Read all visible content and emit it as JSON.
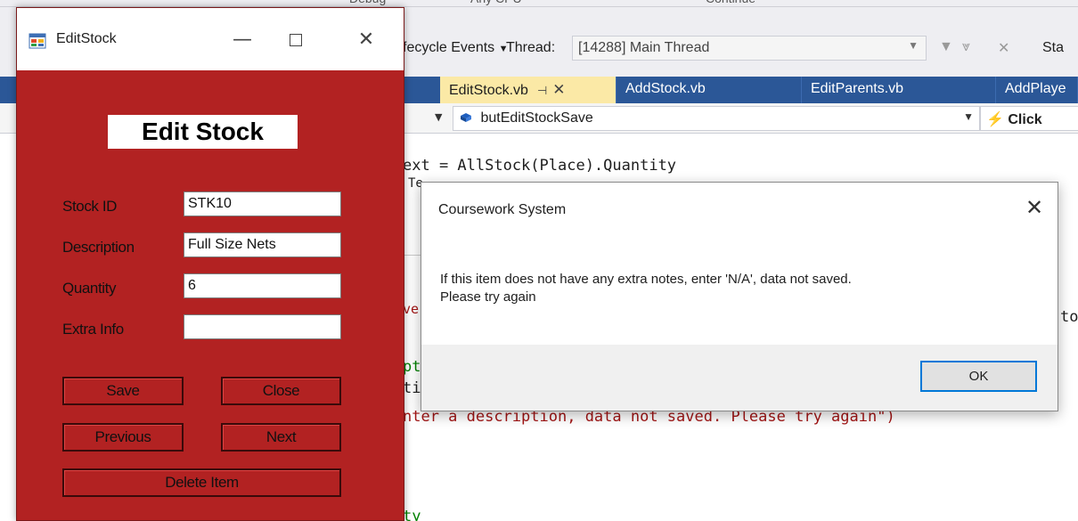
{
  "vs": {
    "top_fragments": [
      "Debug",
      "Any CPU",
      "Continue"
    ],
    "lifecycle_label": "fecycle Events",
    "thread_label": "Thread:",
    "thread_value": "[14288] Main Thread",
    "stack_label": "Sta",
    "tabs": [
      {
        "label": "EditStock.vb",
        "active": true
      },
      {
        "label": "AddStock.vb"
      },
      {
        "label": "EditParents.vb"
      },
      {
        "label": "AddPlaye"
      }
    ],
    "member_dropdown": "butEditStockSave",
    "event_dropdown": "Click",
    "code_lines": [
      "ext = AllStock(Place).Quantity",
      "Te",
      "ve",
      "pt",
      "ti",
      "nter a description, data not saved. Please try again\")",
      "ty"
    ],
    "code_right_fragment": "to",
    "colors": {
      "tab_strip": "#2b5797",
      "active_tab": "#fbe9a6",
      "string": "#a31515"
    }
  },
  "editstock": {
    "window_title": "EditStock",
    "heading": "Edit Stock",
    "fields": {
      "stock_id": {
        "label": "Stock ID",
        "value": "STK10"
      },
      "description": {
        "label": "Description",
        "value": "Full Size Nets"
      },
      "quantity": {
        "label": "Quantity",
        "value": "6"
      },
      "extra_info": {
        "label": "Extra Info",
        "value": ""
      }
    },
    "buttons": {
      "save": "Save",
      "close": "Close",
      "previous": "Previous",
      "next": "Next",
      "delete": "Delete Item"
    },
    "colors": {
      "form_bg": "#b22222"
    }
  },
  "msgbox": {
    "title": "Coursework System",
    "message_line1": "If this item does not have any extra notes, enter 'N/A', data not saved.",
    "message_line2": "Please try again",
    "ok_label": "OK",
    "colors": {
      "ok_border": "#0078d7"
    }
  }
}
